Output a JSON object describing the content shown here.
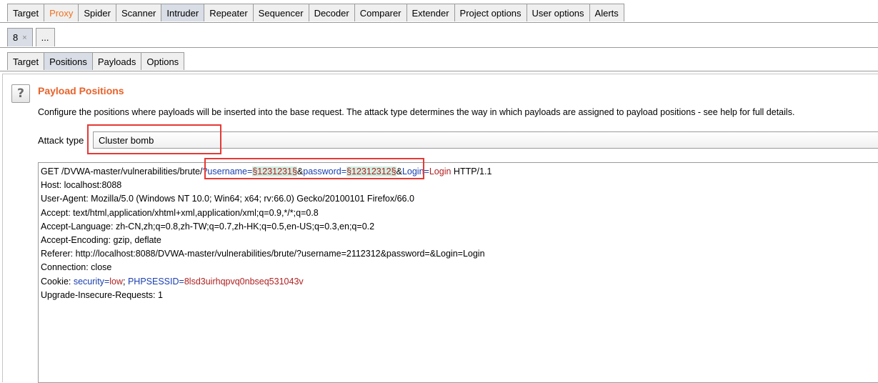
{
  "main_tabs": [
    {
      "label": "Target"
    },
    {
      "label": "Proxy",
      "accent": "#f0701e"
    },
    {
      "label": "Spider"
    },
    {
      "label": "Scanner"
    },
    {
      "label": "Intruder",
      "active": true
    },
    {
      "label": "Repeater"
    },
    {
      "label": "Sequencer"
    },
    {
      "label": "Decoder"
    },
    {
      "label": "Comparer"
    },
    {
      "label": "Extender"
    },
    {
      "label": "Project options"
    },
    {
      "label": "User options"
    },
    {
      "label": "Alerts"
    }
  ],
  "session_tabs": {
    "current": "8",
    "close": "×",
    "more": "..."
  },
  "sub_tabs": [
    {
      "label": "Target"
    },
    {
      "label": "Positions",
      "active": true
    },
    {
      "label": "Payloads"
    },
    {
      "label": "Options"
    }
  ],
  "panel": {
    "help_icon": "?",
    "title": "Payload Positions",
    "description": "Configure the positions where payloads will be inserted into the base request. The attack type determines the way in which payloads are assigned to payload positions - see help for full details.",
    "attack_type_label": "Attack type",
    "attack_type_value": "Cluster bomb"
  },
  "request": {
    "line1": {
      "prefix": "GET /DVWA-master/vulnerabilities/brute/",
      "q": "?",
      "p1": "username",
      "eq1": "=",
      "m1": "§1231231§",
      "amp1": "&",
      "p2": "password",
      "eq2": "=",
      "m2": "§12312312§",
      "amp2": "&",
      "p3": "Login",
      "eq3": "=",
      "v3": "Login",
      "suffix": " HTTP/1.1"
    },
    "host": "Host: localhost:8088",
    "user_agent": "User-Agent: Mozilla/5.0 (Windows NT 10.0; Win64; x64; rv:66.0) Gecko/20100101 Firefox/66.0",
    "accept": "Accept: text/html,application/xhtml+xml,application/xml;q=0.9,*/*;q=0.8",
    "accept_language": "Accept-Language: zh-CN,zh;q=0.8,zh-TW;q=0.7,zh-HK;q=0.5,en-US;q=0.3,en;q=0.2",
    "accept_encoding": "Accept-Encoding: gzip, deflate",
    "referer": "Referer: http://localhost:8088/DVWA-master/vulnerabilities/brute/?username=2112312&password=&Login=Login",
    "connection": "Connection: close",
    "cookie": {
      "prefix": "Cookie: ",
      "n1": "security",
      "eq1": "=",
      "v1": "low",
      "sep": "; ",
      "n2": "PHPSESSID",
      "eq2": "=",
      "v2": "8lsd3uirhqpvq0nbseq531043v"
    },
    "upgrade": "Upgrade-Insecure-Requests: 1"
  }
}
